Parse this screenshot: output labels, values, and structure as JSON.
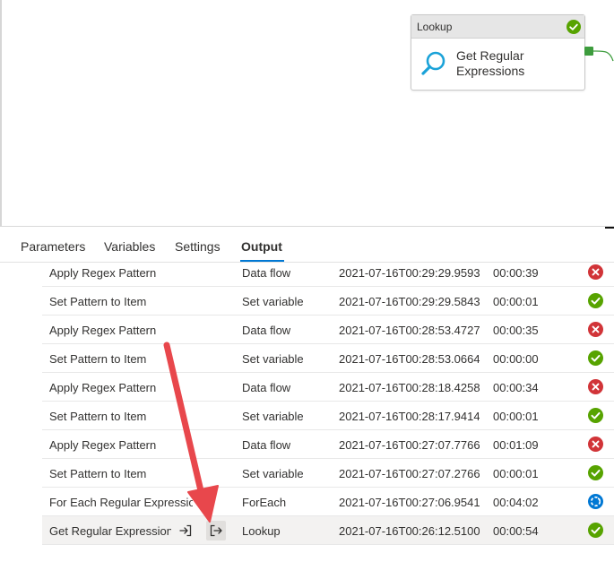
{
  "canvas": {
    "activity": {
      "type": "Lookup",
      "name_line1": "Get Regular",
      "name_line2": "Expressions",
      "status_icon": "success-check-icon"
    }
  },
  "tabs": [
    {
      "label": "Parameters"
    },
    {
      "label": "Variables"
    },
    {
      "label": "Settings"
    },
    {
      "label": "Output",
      "active": true
    }
  ],
  "runs": [
    {
      "name": "Apply Regex Pattern",
      "type": "Data flow",
      "start": "2021-07-16T00:29:29.95939",
      "duration": "00:00:39",
      "status": "failed"
    },
    {
      "name": "Set Pattern to Item",
      "type": "Set variable",
      "start": "2021-07-16T00:29:29.58433",
      "duration": "00:00:01",
      "status": "succeeded"
    },
    {
      "name": "Apply Regex Pattern",
      "type": "Data flow",
      "start": "2021-07-16T00:28:53.47273",
      "duration": "00:00:35",
      "status": "failed"
    },
    {
      "name": "Set Pattern to Item",
      "type": "Set variable",
      "start": "2021-07-16T00:28:53.06647",
      "duration": "00:00:00",
      "status": "succeeded"
    },
    {
      "name": "Apply Regex Pattern",
      "type": "Data flow",
      "start": "2021-07-16T00:28:18.42584",
      "duration": "00:00:34",
      "status": "failed"
    },
    {
      "name": "Set Pattern to Item",
      "type": "Set variable",
      "start": "2021-07-16T00:28:17.94146",
      "duration": "00:00:01",
      "status": "succeeded"
    },
    {
      "name": "Apply Regex Pattern",
      "type": "Data flow",
      "start": "2021-07-16T00:27:07.77662",
      "duration": "00:01:09",
      "status": "failed"
    },
    {
      "name": "Set Pattern to Item",
      "type": "Set variable",
      "start": "2021-07-16T00:27:07.27661",
      "duration": "00:00:01",
      "status": "succeeded"
    },
    {
      "name": "For Each Regular Expression",
      "type": "ForEach",
      "start": "2021-07-16T00:27:06.95417",
      "duration": "00:04:02",
      "status": "in-progress"
    },
    {
      "name": "Get Regular Expressions",
      "type": "Lookup",
      "start": "2021-07-16T00:26:12.51003",
      "duration": "00:00:54",
      "status": "succeeded"
    }
  ],
  "colors": {
    "succeeded": "#57a300",
    "failed": "#d13438",
    "in_progress": "#0078d4",
    "accent": "#0078d4",
    "annotation_arrow": "#e8474c"
  }
}
